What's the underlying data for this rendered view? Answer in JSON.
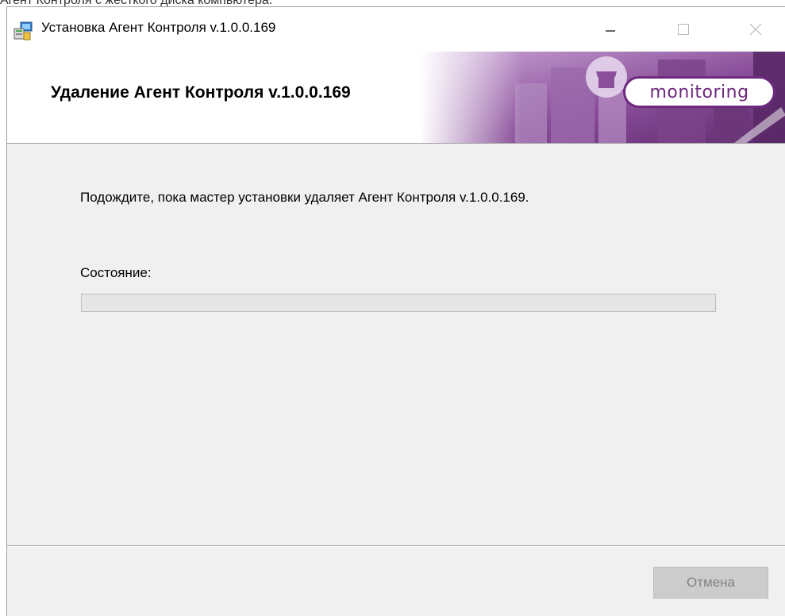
{
  "caption_fragment": "Агент Контроля с жесткого диска компьютера.",
  "window": {
    "title": "Установка Агент Контроля v.1.0.0.169",
    "icon": "installer-icon",
    "controls": {
      "minimize": "minimize-icon",
      "maximize": "maximize-icon",
      "close": "close-icon"
    }
  },
  "banner": {
    "title": "Удаление Агент Контроля v.1.0.0.169",
    "logo_text": "monitoring",
    "brand_color": "#6e2a7e"
  },
  "content": {
    "message": "Подождите, пока мастер установки удаляет Агент Контроля v.1.0.0.169.",
    "status_label": "Состояние:",
    "progress": 0
  },
  "footer": {
    "cancel_label": "Отмена"
  }
}
